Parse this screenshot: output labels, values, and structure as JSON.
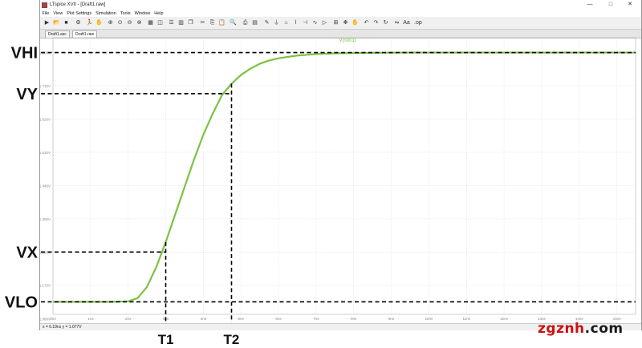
{
  "window": {
    "title": "LTspice XVII - [Draft1.raw]",
    "controls": {
      "minimize": "—",
      "maximize": "□",
      "close": "✕"
    }
  },
  "menu": [
    "File",
    "View",
    "Plot Settings",
    "Simulation",
    "Tools",
    "Window",
    "Help"
  ],
  "toolbar_icons": [
    "new-schematic-icon",
    "open-icon",
    "save-icon",
    "control-panel-icon",
    "run-icon",
    "halt-icon",
    "zoom-in-icon",
    "zoom-area-icon",
    "zoom-out-icon",
    "zoom-fit-icon",
    "autorange-icon",
    "waveform-icon",
    "tile-horizontal-icon",
    "tile-vertical-icon",
    "cascade-icon",
    "cut-icon",
    "copy-icon",
    "paste-icon",
    "find-icon",
    "print-icon",
    "print-preview-icon",
    "wire-icon",
    "ground-icon",
    "label-icon",
    "resistor-icon",
    "capacitor-icon",
    "inductor-icon",
    "diode-icon",
    "component-icon",
    "move-icon",
    "drag-icon",
    "undo-icon",
    "redo-icon",
    "rotate-icon",
    "mirror-icon",
    "text-icon",
    "spice-directive-icon"
  ],
  "tabs": [
    {
      "label": "Draft1.asc",
      "active": false
    },
    {
      "label": "Draft1.raw",
      "active": true
    }
  ],
  "status": {
    "cursor": "x = 0.19ns   y = 1.077V"
  },
  "accent_colors": {
    "trace": "#7cc242",
    "grid": "#c8c8c8",
    "axis_text": "#888888"
  },
  "watermark": {
    "part_a": "zgznh",
    "part_b": ".com"
  },
  "chart_data": {
    "type": "line",
    "series": [
      {
        "name": "V(n001)",
        "x": [
          0,
          0.5,
          1.0,
          1.5,
          2.0,
          2.25,
          2.5,
          2.75,
          3.0,
          3.25,
          3.5,
          3.75,
          4.0,
          4.25,
          4.5,
          4.75,
          5.0,
          5.25,
          5.5,
          5.75,
          6.0,
          6.5,
          7.0,
          7.5,
          8.0,
          8.5,
          9.0,
          9.5,
          10.0,
          11.0,
          12.0,
          13.0,
          14.0,
          15.0,
          15.5
        ],
        "y": [
          0.0,
          0.0,
          0.0,
          0.0,
          0.002,
          0.015,
          0.06,
          0.14,
          0.24,
          0.35,
          0.46,
          0.57,
          0.67,
          0.755,
          0.83,
          0.875,
          0.91,
          0.935,
          0.955,
          0.968,
          0.977,
          0.988,
          0.994,
          0.997,
          0.998,
          0.999,
          0.9995,
          1.0,
          1.0,
          1.0,
          1.0,
          1.0,
          1.0,
          1.0,
          1.0
        ]
      }
    ],
    "x_ticks": [
      "0ns",
      "1ns",
      "2ns",
      "3ns",
      "4ns",
      "5ns",
      "6ns",
      "7ns",
      "8ns",
      "9ns",
      "10ns",
      "11ns",
      "12ns",
      "13ns",
      "14ns",
      "15ns"
    ],
    "xlim": [
      0,
      15.5
    ],
    "ylim": [
      -0.05,
      1.05
    ],
    "y_ticks": [
      {
        "v": 1.0,
        "label": "1.800V"
      },
      {
        "v": 0.867,
        "label": "1.710V"
      },
      {
        "v": 0.733,
        "label": "1.620V"
      },
      {
        "v": 0.6,
        "label": "1.530V"
      },
      {
        "v": 0.467,
        "label": "1.440V"
      },
      {
        "v": 0.333,
        "label": "1.350V"
      },
      {
        "v": 0.2,
        "label": "1.260V"
      },
      {
        "v": 0.067,
        "label": "1.170V"
      },
      {
        "v": -0.067,
        "label": "1.080V"
      }
    ],
    "grid": true,
    "annotations": {
      "levels": [
        {
          "label": "VHI",
          "v": 1.0
        },
        {
          "label": "VY",
          "v": 0.835
        },
        {
          "label": "VX",
          "v": 0.2
        },
        {
          "label": "VLO",
          "v": 0.0
        }
      ],
      "times": [
        {
          "label": "T1",
          "t": 3.0
        },
        {
          "label": "T2",
          "t": 4.75
        }
      ]
    }
  }
}
